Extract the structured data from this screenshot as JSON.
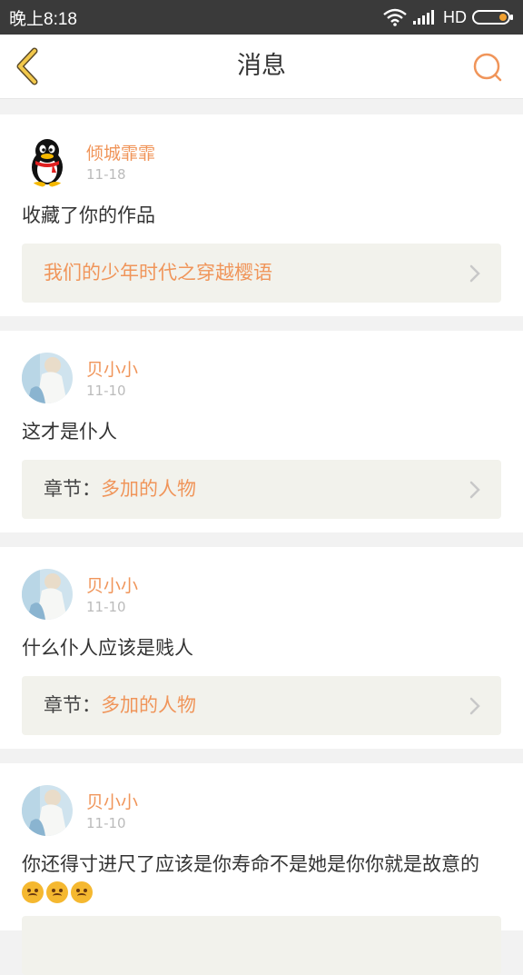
{
  "status_bar": {
    "time": "晚上8:18",
    "network": "HD"
  },
  "header": {
    "title": "消息"
  },
  "messages": [
    {
      "user": "倾城霏霏",
      "date": "11-18",
      "text": "收藏了你的作品",
      "ref_prefix": "",
      "ref_link": "我们的少年时代之穿越樱语",
      "avatar": "qq-penguin"
    },
    {
      "user": "贝小小",
      "date": "11-10",
      "text": "这才是仆人",
      "ref_prefix": "章节：",
      "ref_link": "多加的人物",
      "avatar": "girl-photo"
    },
    {
      "user": "贝小小",
      "date": "11-10",
      "text": "什么仆人应该是贱人",
      "ref_prefix": "章节：",
      "ref_link": "多加的人物",
      "avatar": "girl-photo"
    },
    {
      "user": "贝小小",
      "date": "11-10",
      "text": "你还得寸进尺了应该是你寿命不是她是你你就是故意的",
      "ref_prefix": "",
      "ref_link": "",
      "avatar": "girl-photo",
      "emoji": [
        "sad-face",
        "sad-face",
        "sad-face"
      ]
    }
  ],
  "colors": {
    "accent": "#f0955a",
    "back_arrow": "#f2c84b",
    "ref_bg": "#f2f2ec"
  }
}
